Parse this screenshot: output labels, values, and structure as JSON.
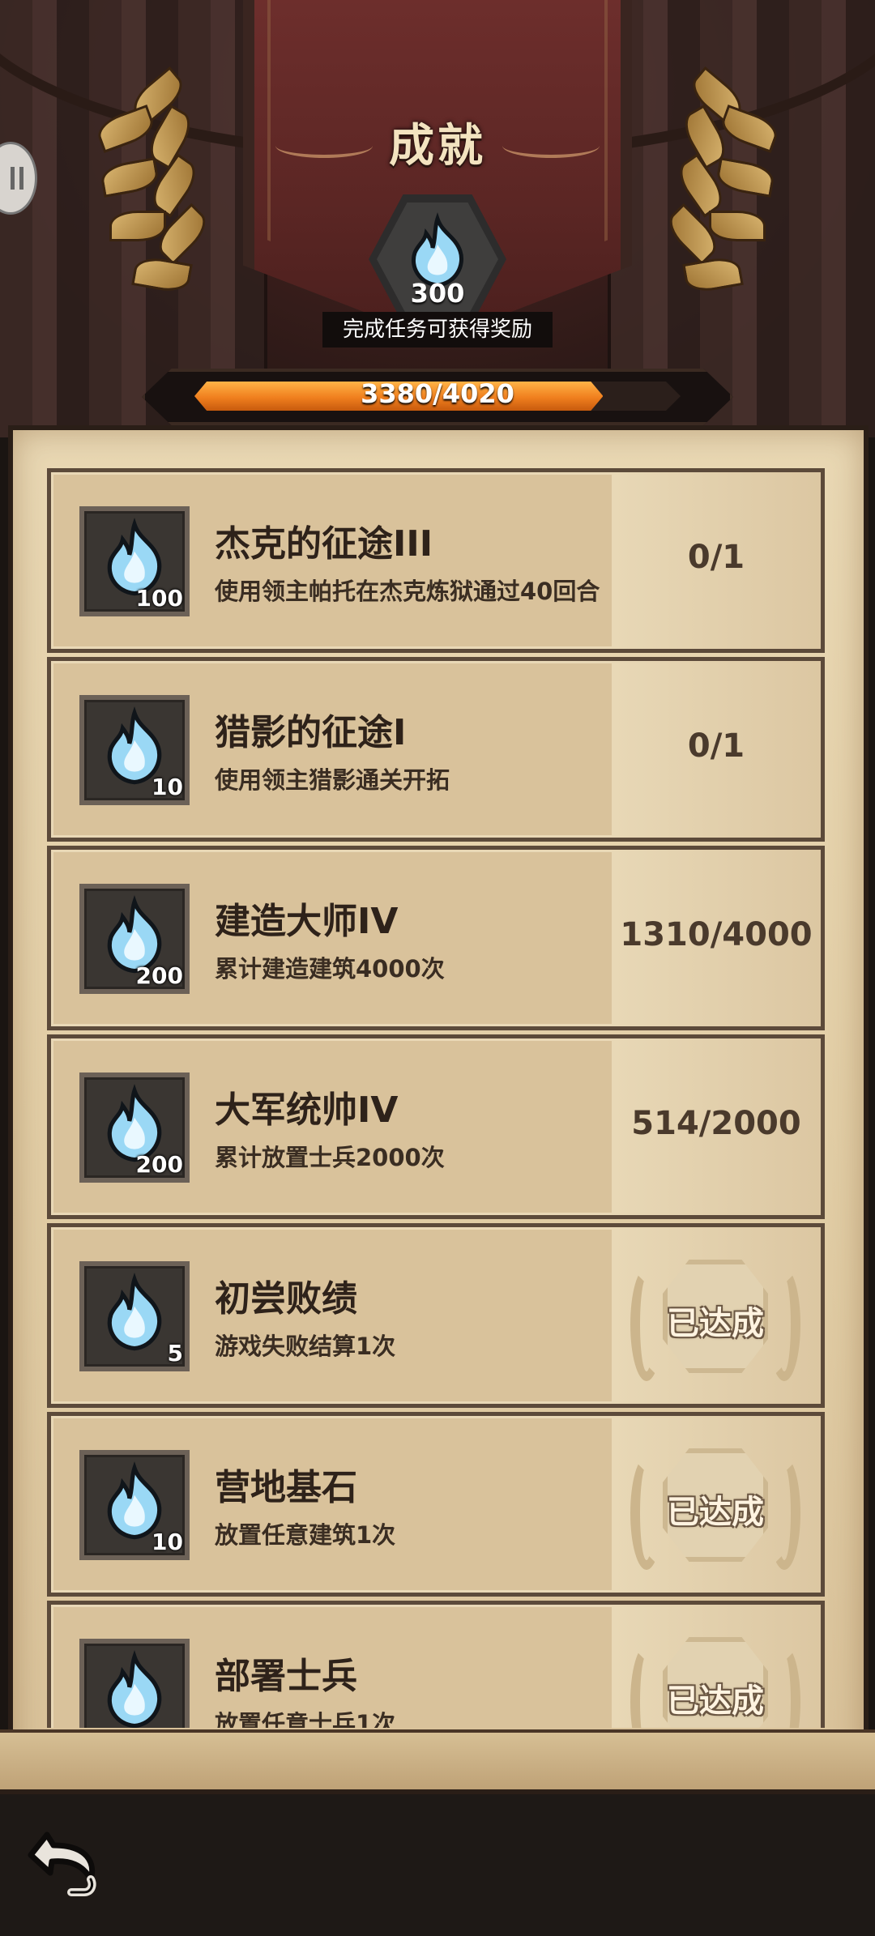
{
  "header": {
    "title": "成就",
    "reward_amount": "300",
    "reward_tip": "完成任务可获得奖励",
    "progress_text": "3380/4020",
    "progress_fraction": 0.8408
  },
  "colors": {
    "accent_orange": "#f07f1e",
    "flame_blue": "#8fd3f4",
    "parchment": "#e2cea6"
  },
  "achievements": [
    {
      "title": "杰克的征途III",
      "desc": "使用领主帕托在杰克炼狱通过40回合",
      "reward": "100",
      "progress": "0/1",
      "done": false
    },
    {
      "title": "猎影的征途I",
      "desc": "使用领主猎影通关开拓",
      "reward": "10",
      "progress": "0/1",
      "done": false
    },
    {
      "title": "建造大师IV",
      "desc": "累计建造建筑4000次",
      "reward": "200",
      "progress": "1310/4000",
      "done": false
    },
    {
      "title": "大军统帅IV",
      "desc": "累计放置士兵2000次",
      "reward": "200",
      "progress": "514/2000",
      "done": false
    },
    {
      "title": "初尝败绩",
      "desc": "游戏失败结算1次",
      "reward": "5",
      "status": "已达成",
      "done": true
    },
    {
      "title": "营地基石",
      "desc": "放置任意建筑1次",
      "reward": "10",
      "status": "已达成",
      "done": true
    },
    {
      "title": "部署士兵",
      "desc": "放置任意士兵1次",
      "reward": "",
      "status": "已达成",
      "done": true
    }
  ],
  "footer": {
    "back_icon": "back-arrow-icon"
  }
}
